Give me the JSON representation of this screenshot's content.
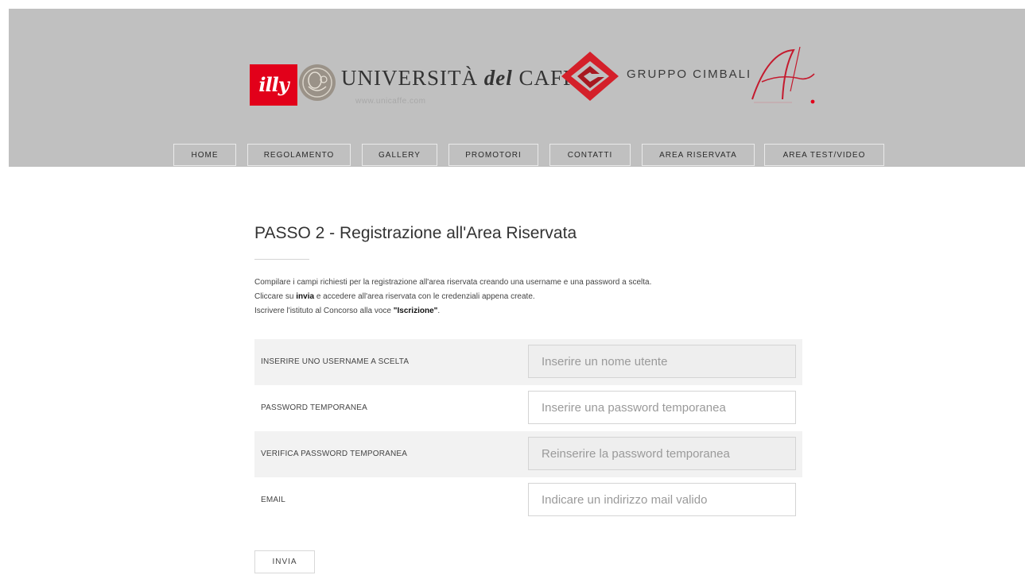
{
  "logos": {
    "illy": "illy",
    "universita": {
      "prefix": "UNIVERSITÀ",
      "del": "del",
      "suffix": "CAFFÈ",
      "url": "www.unicaffe.com"
    },
    "cimbali": "GRUPPO CIMBALI"
  },
  "nav": [
    {
      "label": "HOME"
    },
    {
      "label": "REGOLAMENTO"
    },
    {
      "label": "GALLERY"
    },
    {
      "label": "PROMOTORI"
    },
    {
      "label": "CONTATTI"
    },
    {
      "label": "AREA RISERVATA"
    },
    {
      "label": "AREA TEST/VIDEO"
    }
  ],
  "page": {
    "title": "PASSO 2 - Registrazione all'Area Riservata",
    "intro": {
      "line1": "Compilare i campi richiesti per la registrazione all'area riservata creando una username e una password a scelta.",
      "line2_a": "Cliccare su ",
      "line2_b": "invia",
      "line2_c": " e accedere all'area riservata con le credenziali appena create.",
      "line3_a": "Iscrivere l'istituto al Concorso alla voce ",
      "line3_b": "\"Iscrizione\"",
      "line3_c": "."
    }
  },
  "form": {
    "rows": [
      {
        "label": "INSERIRE UNO USERNAME A SCELTA",
        "placeholder": "Inserire un nome utente",
        "value": ""
      },
      {
        "label": "PASSWORD TEMPORANEA",
        "placeholder": "Inserire una password temporanea",
        "value": ""
      },
      {
        "label": "VERIFICA PASSWORD TEMPORANEA",
        "placeholder": "Reinserire la password temporanea",
        "value": ""
      },
      {
        "label": "EMAIL",
        "placeholder": "Indicare un indirizzo mail valido",
        "value": ""
      }
    ],
    "submit_label": "INVIA"
  },
  "colors": {
    "header_bg": "#c0c0c0",
    "illy_red": "#e2001a",
    "cimbali_red": "#d4202a",
    "row_shade": "#f2f2f2"
  }
}
